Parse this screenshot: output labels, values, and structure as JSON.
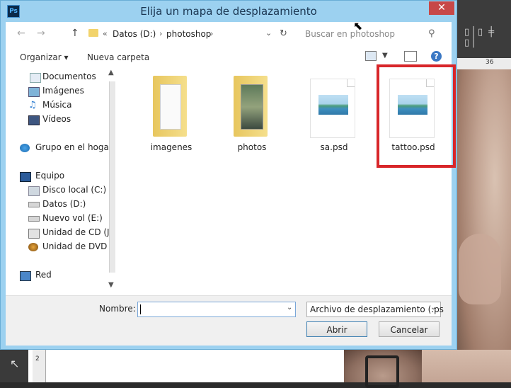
{
  "dialog": {
    "title": "Elija un mapa de desplazamiento",
    "app_icon": "Ps",
    "close_label": "✕"
  },
  "nav": {
    "path": [
      "Datos (D:)",
      "photoshop"
    ],
    "search_placeholder": "Buscar en photoshop"
  },
  "toolbar": {
    "organize_label": "Organizar ▾",
    "new_folder_label": "Nueva carpeta"
  },
  "sidebar": {
    "items": [
      {
        "label": "Documentos",
        "icon": "documents-icon"
      },
      {
        "label": "Imágenes",
        "icon": "pictures-icon"
      },
      {
        "label": "Música",
        "icon": "music-icon"
      },
      {
        "label": "Vídeos",
        "icon": "videos-icon"
      },
      {
        "label": "Grupo en el hogar",
        "icon": "homegroup-icon"
      },
      {
        "label": "Equipo",
        "icon": "computer-icon"
      },
      {
        "label": "Disco local (C:)",
        "icon": "drive-icon"
      },
      {
        "label": "Datos (D:)",
        "icon": "drive-icon"
      },
      {
        "label": "Nuevo vol (E:)",
        "icon": "drive-icon"
      },
      {
        "label": "Unidad de CD (J:",
        "icon": "cd-drive-icon"
      },
      {
        "label": "Unidad de DVD (",
        "icon": "dvd-drive-icon"
      },
      {
        "label": "Red",
        "icon": "network-icon"
      }
    ]
  },
  "files": [
    {
      "name": "imagenes",
      "type": "folder"
    },
    {
      "name": "photos",
      "type": "folder"
    },
    {
      "name": "sa.psd",
      "type": "psd"
    },
    {
      "name": "tattoo.psd",
      "type": "psd",
      "highlighted": true
    }
  ],
  "bottom": {
    "name_label": "Nombre:",
    "name_value": "",
    "file_type": "Archivo de desplazamiento (.ps",
    "open_label": "Abrir",
    "cancel_label": "Cancelar"
  },
  "photoshop": {
    "ruler_top": "36",
    "ruler_left": "2"
  },
  "colors": {
    "title_bar": "#9cd1f0",
    "close_button": "#c74848",
    "highlight": "#d8262a"
  }
}
